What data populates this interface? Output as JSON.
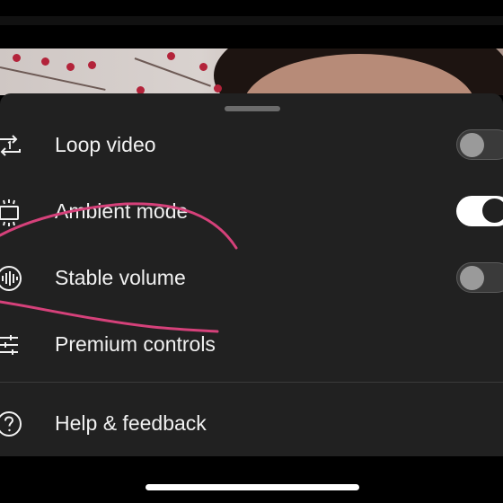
{
  "menu": {
    "items": [
      {
        "label": "Loop video",
        "icon": "loop-icon",
        "toggle": "off"
      },
      {
        "label": "Ambient mode",
        "icon": "ambient-mode-icon",
        "toggle": "on"
      },
      {
        "label": "Stable volume",
        "icon": "stable-volume-icon",
        "toggle": "off"
      },
      {
        "label": "Premium controls",
        "icon": "sliders-icon"
      }
    ],
    "help": {
      "label": "Help & feedback",
      "icon": "help-icon"
    }
  },
  "annotation_color": "#d5417a",
  "colors": {
    "sheet_bg": "#212121",
    "toggle_on": "#ffffff",
    "toggle_off": "#3a3a3a"
  }
}
